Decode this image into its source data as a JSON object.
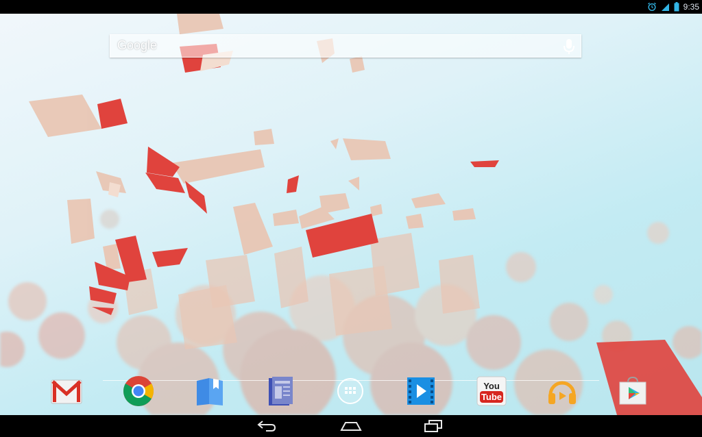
{
  "status_bar": {
    "time": "9:35",
    "icons": [
      "alarm-icon",
      "signal-icon",
      "battery-icon"
    ]
  },
  "search": {
    "logo_text": "Google",
    "mic_icon": "mic-icon"
  },
  "dock": {
    "apps": [
      {
        "name": "gmail-icon"
      },
      {
        "name": "chrome-icon"
      },
      {
        "name": "play-books-icon"
      },
      {
        "name": "play-magazines-icon"
      },
      {
        "name": "all-apps-icon"
      },
      {
        "name": "play-movies-icon"
      },
      {
        "name": "youtube-icon",
        "label": "You Tube"
      },
      {
        "name": "play-music-icon"
      },
      {
        "name": "play-store-icon"
      }
    ]
  },
  "nav_bar": {
    "buttons": [
      "back-icon",
      "home-icon",
      "recents-icon"
    ]
  },
  "colors": {
    "wallpaper_sky": "#c3ebf3",
    "shard_red": "#e0433d",
    "shard_beige": "#e9c6b4",
    "youtube_red": "#d7261f",
    "movies_blue": "#1a8fe3",
    "music_orange": "#f5a623"
  }
}
